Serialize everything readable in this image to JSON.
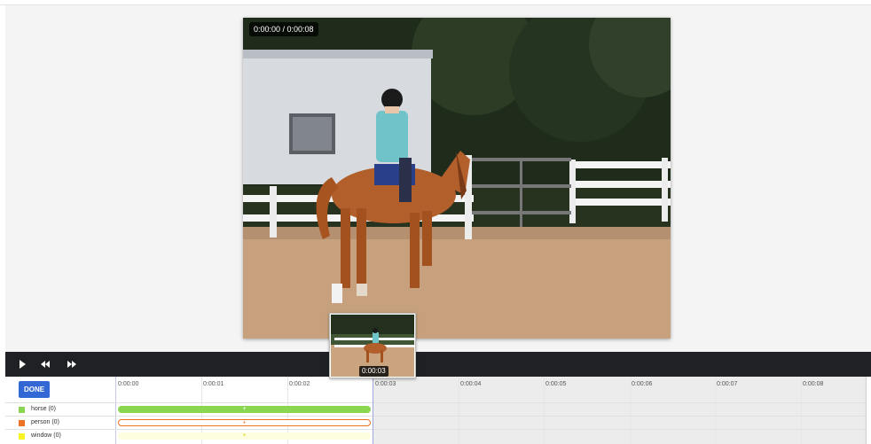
{
  "player": {
    "timecode": "0:00:00 / 0:00:08",
    "thumbnail_time": "0:00:03"
  },
  "controls": {
    "play": "play-icon",
    "rewind": "rewind-icon",
    "fast_forward": "fast-forward-icon"
  },
  "timeline": {
    "done_label": "DONE",
    "ticks": [
      "0:00:00",
      "0:00:01",
      "0:00:02",
      "0:00:03",
      "0:00:04",
      "0:00:05",
      "0:00:06",
      "0:00:07",
      "0:00:08"
    ],
    "labels": [
      {
        "name": "horse (0)",
        "color": "#8bd651"
      },
      {
        "name": "person (0)",
        "color": "#ec7224"
      },
      {
        "name": "window (0)",
        "color": "#f8f424"
      }
    ],
    "bar_marker": "+"
  },
  "colors": {
    "accent": "#3367d6",
    "control_bar": "#202124"
  }
}
